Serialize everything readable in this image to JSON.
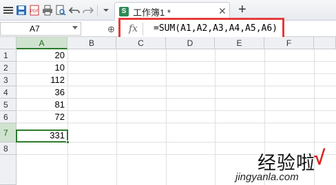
{
  "toolbar": {
    "tab_title": "工作簿1 *",
    "tab_close": "✕",
    "new_tab": "+"
  },
  "formula_bar": {
    "name_box": "A7",
    "fx_label": "fx",
    "zoom_glyph": "⊕",
    "formula": "=SUM(A1,A2,A3,A4,A5,A6)"
  },
  "grid": {
    "columns": [
      "A",
      "B",
      "C",
      "D",
      "E",
      "F"
    ],
    "selected_column": "A",
    "rows": [
      "1",
      "2",
      "3",
      "4",
      "5",
      "6",
      "7",
      "8"
    ],
    "selected_row": "7",
    "column_a_values": [
      "20",
      "10",
      "112",
      "36",
      "81",
      "72",
      "331",
      ""
    ]
  },
  "watermark": {
    "text": "经验啦",
    "check": "√",
    "url": "jingyanla.com"
  },
  "colors": {
    "highlight_border": "#e53b3b",
    "selection_green": "#2a7a2a",
    "header_bg": "#eef0f3"
  }
}
